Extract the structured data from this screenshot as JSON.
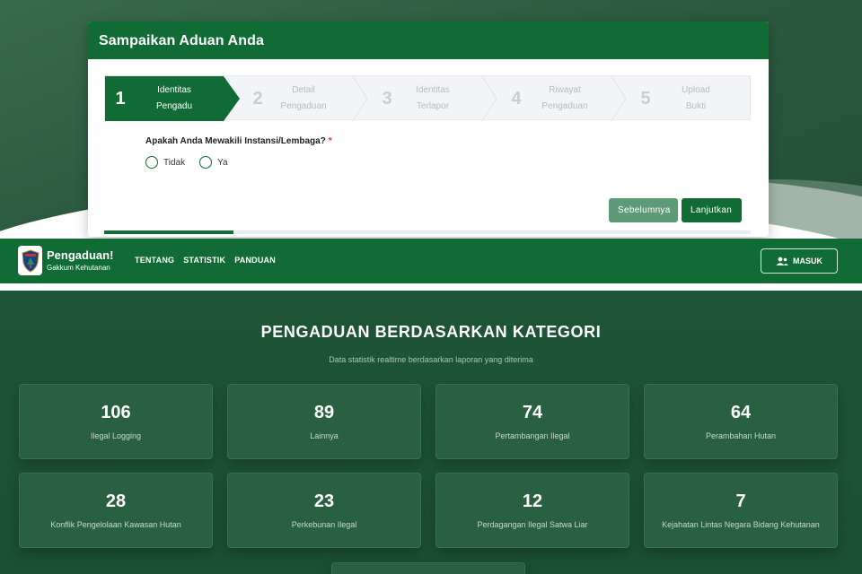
{
  "form": {
    "title": "Sampaikan Aduan Anda",
    "steps": [
      {
        "num": "1",
        "line1": "Identitas",
        "line2": "Pengadu"
      },
      {
        "num": "2",
        "line1": "Detail",
        "line2": "Pengaduan"
      },
      {
        "num": "3",
        "line1": "Identitas",
        "line2": "Terlapor"
      },
      {
        "num": "4",
        "line1": "Riwayat",
        "line2": "Pengaduan"
      },
      {
        "num": "5",
        "line1": "Upload",
        "line2": "Bukti"
      }
    ],
    "active_step": 1,
    "question": "Apakah Anda Mewakili Instansi/Lembaga?",
    "required_mark": "*",
    "options": [
      "Tidak",
      "Ya"
    ],
    "prev_label": "Sebelumnya",
    "next_label": "Lanjutkan",
    "progress_fraction": 0.2
  },
  "navbar": {
    "brand_title": "Pengaduan!",
    "brand_subtitle": "Gakkum Kehutanan",
    "links": [
      "TENTANG",
      "STATISTIK",
      "PANDUAN"
    ],
    "login_label": "MASUK"
  },
  "stats": {
    "title": "PENGADUAN BERDASARKAN KATEGORI",
    "subtitle": "Data statistik realtime berdasarkan laporan yang diterima",
    "cards": [
      {
        "value": "106",
        "label": "Ilegal Logging"
      },
      {
        "value": "89",
        "label": "Lainnya"
      },
      {
        "value": "74",
        "label": "Pertambangan Ilegal"
      },
      {
        "value": "64",
        "label": "Perambahan Hutan"
      },
      {
        "value": "28",
        "label": "Konflik Pengelolaan Kawasan Hutan"
      },
      {
        "value": "23",
        "label": "Perkebunan Ilegal"
      },
      {
        "value": "12",
        "label": "Perdagangan Ilegal Satwa Liar"
      },
      {
        "value": "7",
        "label": "Kejahatan Lintas Negara Bidang Kehutanan"
      }
    ]
  },
  "colors": {
    "primary": "#116b34",
    "muted_button": "#5f9a78",
    "stats_background": "#1f5537"
  }
}
